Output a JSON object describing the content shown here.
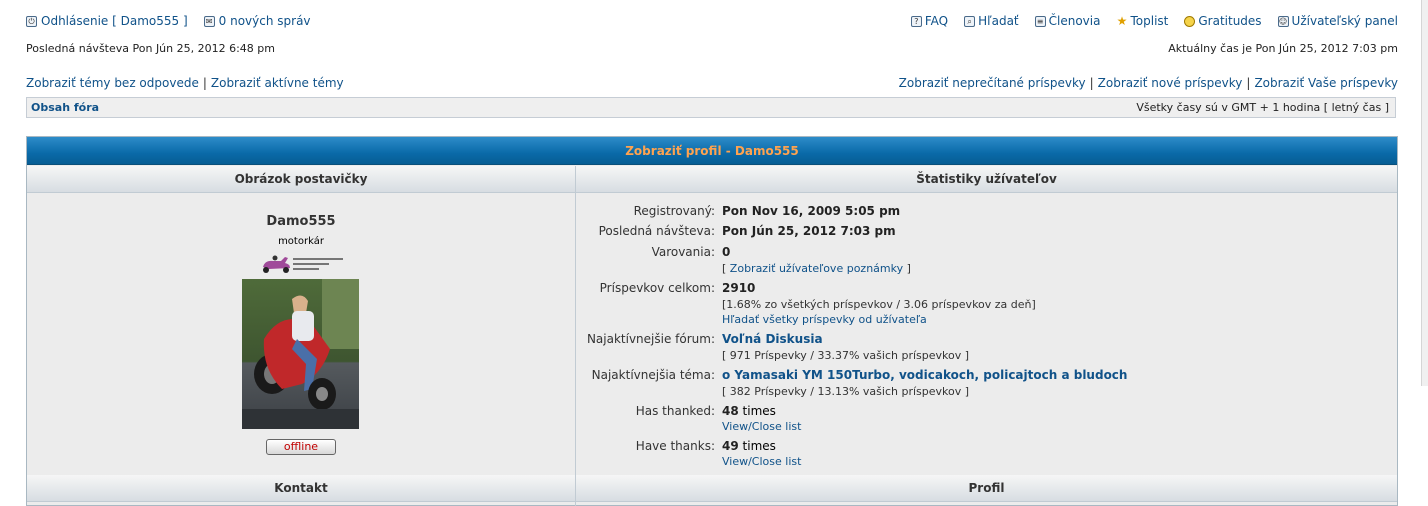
{
  "top": {
    "logout": "Odhlásenie [ Damo555 ]",
    "messages": "0 nových správ",
    "nav": [
      {
        "label": "FAQ",
        "icon": "faq-icon"
      },
      {
        "label": "Hľadať",
        "icon": "search-icon"
      },
      {
        "label": "Členovia",
        "icon": "members-icon"
      },
      {
        "label": "Toplist",
        "icon": "star-icon"
      },
      {
        "label": "Gratitudes",
        "icon": "gratitudes-icon"
      },
      {
        "label": "Užívateľský panel",
        "icon": "user-panel-icon"
      }
    ]
  },
  "info": {
    "last_visit": "Posledná návšteva Pon Jún 25, 2012 6:48 pm",
    "current_time": "Aktuálny čas je Pon Jún 25, 2012 7:03 pm"
  },
  "links": {
    "left": [
      "Zobraziť témy bez odpovede",
      "Zobraziť aktívne témy"
    ],
    "right": [
      "Zobraziť neprečítané príspevky",
      "Zobraziť nové príspevky",
      "Zobraziť Vaše príspevky"
    ]
  },
  "navbar": {
    "crumb": "Obsah fóra",
    "timezone": "Všetky časy sú v GMT + 1 hodina [ letný čas ]"
  },
  "profile": {
    "caption": "Zobraziť profil - Damo555",
    "col_left": "Obrázok postavičky",
    "col_right": "Štatistiky užívateľov",
    "username": "Damo555",
    "rank": "motorkár",
    "status": "offline",
    "col_left2": "Kontakt",
    "col_right2": "Profil"
  },
  "stats": {
    "registered_label": "Registrovaný:",
    "registered": "Pon Nov 16, 2009 5:05 pm",
    "last_visit_label": "Posledná návšteva:",
    "last_visit": "Pon Jún 25, 2012 7:03 pm",
    "warnings_label": "Varovania:",
    "warnings": "0",
    "warnings_link": "Zobraziť užívateľove poznámky",
    "posts_label": "Príspevkov celkom:",
    "posts": "2910",
    "posts_detail": "[1.68% zo všetkých príspevkov / 3.06 príspevkov za deň]",
    "posts_search": "Hľadať všetky príspevky od užívateľa",
    "active_forum_label": "Najaktívnejšie fórum:",
    "active_forum": "Voľná Diskusia",
    "active_forum_detail": "[ 971 Príspevky / 33.37% vašich príspevkov ]",
    "active_topic_label": "Najaktívnejšia téma:",
    "active_topic": "o Yamasaki YM 150Turbo, vodicakoch, policajtoch a bludoch",
    "active_topic_detail": "[ 382 Príspevky / 13.13% vašich príspevkov ]",
    "has_thanked_label": "Has thanked:",
    "has_thanked": "48",
    "times": "times",
    "have_thanks_label": "Have thanks:",
    "have_thanks": "49",
    "view_close": "View/Close list"
  }
}
